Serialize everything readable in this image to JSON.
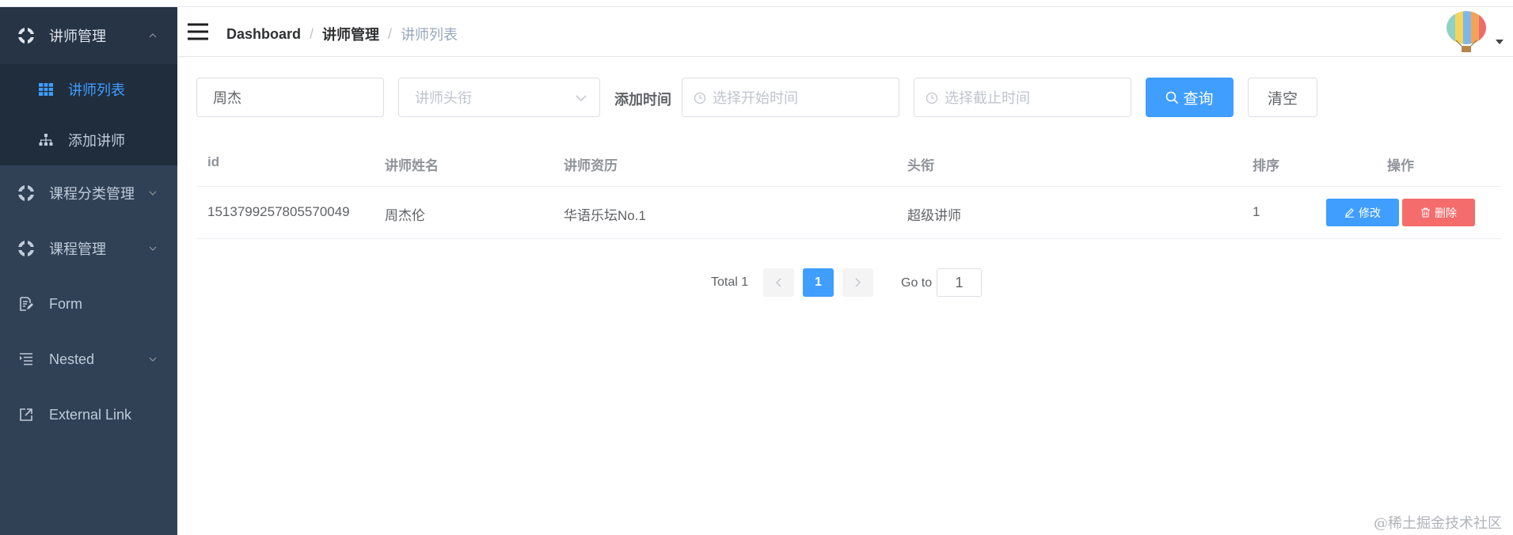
{
  "sidebar": {
    "items": [
      {
        "label": "讲师管理",
        "icon": "lifebuoy-icon"
      },
      {
        "label": "课程分类管理",
        "icon": "lifebuoy-icon"
      },
      {
        "label": "课程管理",
        "icon": "lifebuoy-icon"
      },
      {
        "label": "Form",
        "icon": "form-icon"
      },
      {
        "label": "Nested",
        "icon": "list-icon"
      },
      {
        "label": "External Link",
        "icon": "external-link-icon"
      }
    ],
    "submenu": [
      {
        "label": "讲师列表",
        "icon": "table-icon"
      },
      {
        "label": "添加讲师",
        "icon": "tree-icon"
      }
    ],
    "active_color": "#409eff",
    "bg_color": "#304156"
  },
  "header": {
    "breadcrumb": [
      "Dashboard",
      "讲师管理",
      "讲师列表"
    ]
  },
  "filter": {
    "name_value": "周杰",
    "level_placeholder": "讲师头衔",
    "time_label": "添加时间",
    "start_placeholder": "选择开始时间",
    "end_placeholder": "选择截止时间",
    "query_label": "查询",
    "clear_label": "清空"
  },
  "table": {
    "columns": [
      "id",
      "讲师姓名",
      "讲师资历",
      "头衔",
      "排序",
      "操作"
    ],
    "rows": [
      {
        "id": "1513799257805570049",
        "name": "周杰伦",
        "intro": "华语乐坛No.1",
        "level": "超级讲师",
        "sort": "1"
      }
    ],
    "edit_label": "修改",
    "delete_label": "删除"
  },
  "pagination": {
    "total": "Total 1",
    "current_page": "1",
    "goto_label": "Go to",
    "goto_value": "1"
  },
  "watermark": "@稀土掘金技术社区"
}
